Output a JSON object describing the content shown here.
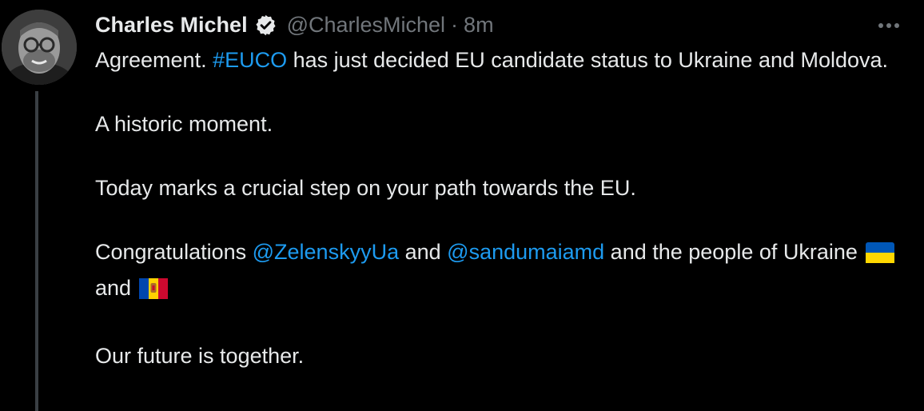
{
  "tweet": {
    "author_name": "Charles Michel",
    "author_handle": "@CharlesMichel",
    "separator": "·",
    "time": "8m",
    "line1_before": "Agreement. ",
    "hashtag": "#EUCO",
    "line1_after": " has just decided EU candidate status to Ukraine and Moldova.",
    "para2": "A historic moment.",
    "para3": "Today marks a crucial step on your path towards the EU.",
    "para4_start": "Congratulations ",
    "mention1": "@ZelenskyyUa",
    "para4_mid1": " and ",
    "mention2": "@sandumaiamd",
    "para4_mid2": " and the people of Ukraine",
    "para4_mid3": "and",
    "para5": "Our future is together."
  },
  "icons": {
    "verified": "verified-badge-icon",
    "more": "more-options-icon",
    "flag_ukraine": "flag-ukraine-icon",
    "flag_moldova": "flag-moldova-icon"
  },
  "colors": {
    "background": "#000000",
    "text": "#e7e9ea",
    "secondary": "#71767b",
    "link": "#1d9bf0",
    "thread_line": "#3a3f44"
  }
}
